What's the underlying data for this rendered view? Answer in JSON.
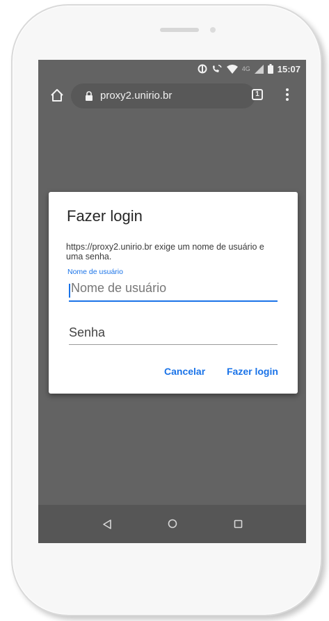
{
  "status_bar": {
    "time": "15:07",
    "network_label": "4G"
  },
  "browser": {
    "url": "proxy2.unirio.br",
    "tab_count": "1"
  },
  "dialog": {
    "title": "Fazer login",
    "message": "https://proxy2.unirio.br exige um nome de usuário e uma senha.",
    "username_label": "Nome de usuário",
    "username_placeholder": "Nome de usuário",
    "username_value": "",
    "password_placeholder": "Senha",
    "password_value": "",
    "cancel_label": "Cancelar",
    "login_label": "Fazer login"
  },
  "nav_bar": {
    "back_icon": "triangle-back-icon",
    "home_icon": "circle-home-icon",
    "recents_icon": "square-recents-icon"
  },
  "colors": {
    "accent": "#1a73e8",
    "screen_dim": "#636363",
    "nav_bar": "#565656"
  }
}
